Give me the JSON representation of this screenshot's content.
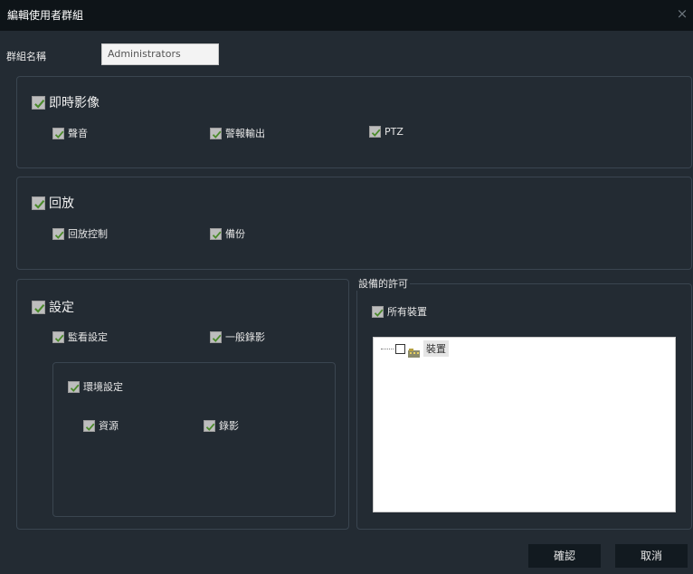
{
  "dialog": {
    "title": "編輯使用者群組",
    "close_glyph": "×"
  },
  "group_name": {
    "label": "群組名稱",
    "value": "Administrators"
  },
  "live_view": {
    "label": "即時影像",
    "checked": true,
    "children": [
      {
        "label": "聲音",
        "checked": true
      },
      {
        "label": "警報輸出",
        "checked": true
      },
      {
        "label": "PTZ",
        "checked": true
      }
    ]
  },
  "playback": {
    "label": "回放",
    "checked": true,
    "children": [
      {
        "label": "回放控制",
        "checked": true
      },
      {
        "label": "備份",
        "checked": true
      }
    ]
  },
  "settings": {
    "label": "設定",
    "checked": true,
    "children": [
      {
        "label": "監看設定",
        "checked": true
      },
      {
        "label": "一般錄影",
        "checked": true
      }
    ],
    "environment": {
      "label": "環境設定",
      "checked": true,
      "children": [
        {
          "label": "資源",
          "checked": true
        },
        {
          "label": "錄影",
          "checked": true
        }
      ]
    }
  },
  "device_permission": {
    "legend": "設備的許可",
    "all_devices": {
      "label": "所有裝置",
      "checked": true
    },
    "tree": [
      {
        "label": "裝置",
        "checked": false,
        "icon": "device-group-icon"
      }
    ]
  },
  "buttons": {
    "confirm": "確認",
    "cancel": "取消"
  },
  "colors": {
    "background": "#232b33",
    "titlebar": "#0e1418",
    "checkbox_fill": "#bdbdbd",
    "check_mark": "#4a8a2a"
  }
}
